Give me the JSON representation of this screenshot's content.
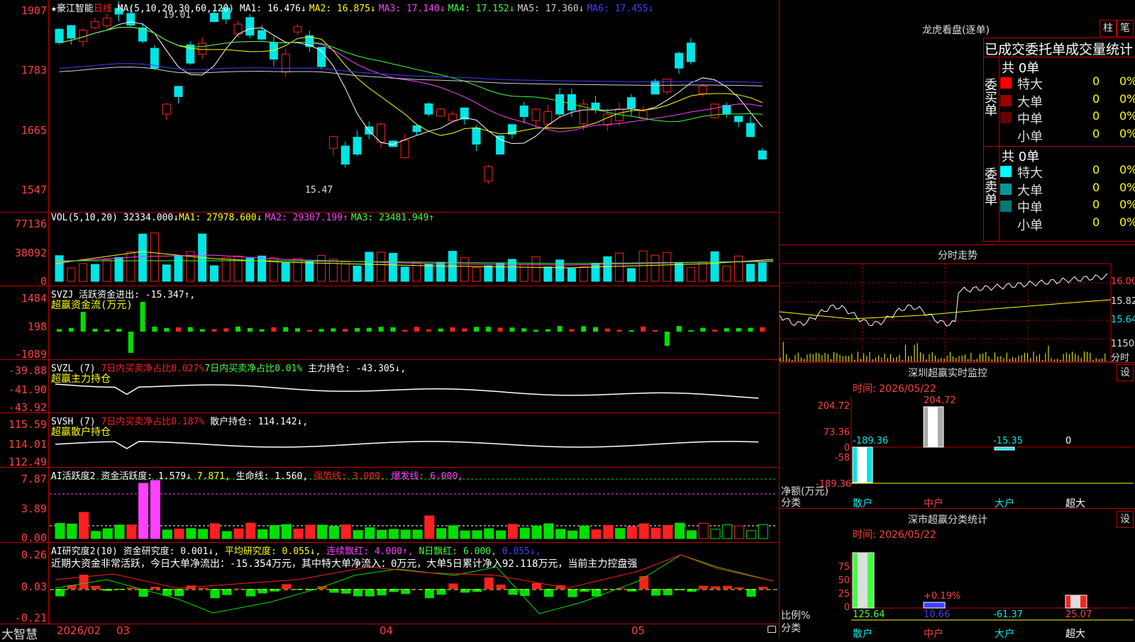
{
  "colors": {
    "up": "#ff2020",
    "down": "#00e5e5",
    "grid": "#c00000",
    "bg": "#000000"
  },
  "main": {
    "stock_name": "★豪江智能",
    "period": "日线",
    "ma_title": "MA(5,10,20,30,60,120)",
    "ma_items": [
      {
        "label": "MA1: 16.476↓",
        "color": "#ffffff"
      },
      {
        "label": "MA2: 16.875↓",
        "color": "#ffff00"
      },
      {
        "label": "MA3: 17.140↓",
        "color": "#ff40ff"
      },
      {
        "label": "MA4: 17.152↓",
        "color": "#40ff40"
      },
      {
        "label": "MA5: 17.360↓",
        "color": "#d0d0d0"
      },
      {
        "label": "MA6: 17.455↓",
        "color": "#4040ff"
      }
    ],
    "axis": [
      "1907",
      "1783",
      "1665",
      "1547"
    ],
    "high_label": "19.01",
    "low_label": "15.47"
  },
  "vol": {
    "title": "VOL(5,10,20)",
    "value": "32334.000↓",
    "items": [
      {
        "label": "MA1: 27978.600↓",
        "color": "#ffff00"
      },
      {
        "label": "MA2: 29307.199↑",
        "color": "#ff40ff"
      },
      {
        "label": "MA3: 23481.949↑",
        "color": "#40ff40"
      }
    ],
    "axis": [
      "77136",
      "38092",
      "0"
    ]
  },
  "svzj": {
    "title": "SVZJ",
    "desc": "活跃资金进出: -15.347↑,",
    "sub": "超赢资金流(万元)",
    "axis": [
      "1484",
      "198",
      "-1089"
    ]
  },
  "svzl": {
    "title": "SVZL (7)",
    "a": "7日内买卖净占比0.027%",
    "b": "7日内买卖净占比0.01%",
    "c": "主力持仓: -43.305↓,",
    "sub": "超赢主力持仓",
    "axis": [
      "-39.88",
      "-41.90",
      "-43.92"
    ]
  },
  "svsh": {
    "title": "SVSH (7)",
    "a": "7日内买卖净占比0.187%",
    "c": "散户持仓: 114.142↓,",
    "sub": "超赢散户持仓",
    "axis": [
      "115.59",
      "114.01",
      "112.49"
    ]
  },
  "ai1": {
    "title": "AI活跃度2",
    "a": "资金活跃度: 1.579↓",
    "b": "7.871,",
    "c": "生命线: 1.560,",
    "d": "强势线: 3.000,",
    "e": "爆发线: 6.000,",
    "axis": [
      "7.87",
      "3.89",
      "0.00"
    ]
  },
  "ai2": {
    "title": "AI研究度2(10)",
    "a": "资金研究度: 0.001↓,",
    "b": "平均研究度: 0.055↓,",
    "c": "连续飘红: 4.000↑,",
    "d": "N日飘红: 6.000,",
    "e": "0.055↓,",
    "note": "近期大资金非常活跃，今日大单净流出：-15.354万元，其中特大单净流入：0万元，大单5日累计净入92.118万元，当前主力控盘强",
    "axis": [
      "0.26",
      "0.03",
      "-0.21"
    ]
  },
  "bottom": {
    "logo": "大智慧",
    "dates": [
      "2026/02",
      "03",
      "04",
      "05"
    ]
  },
  "right": {
    "title": "龙虎看盘(逐单)",
    "btn1": "柱",
    "btn2": "笔",
    "stats_title": "已成交委托单成交量统计",
    "buy_label": "委买单",
    "sell_label": "委卖单",
    "buy_total": "共 0单",
    "sell_total": "共 0单",
    "buy_rows": [
      {
        "label": "特大",
        "v1": "0",
        "v2": "0%",
        "color": "#ff0000"
      },
      {
        "label": "大单",
        "v1": "0",
        "v2": "0%",
        "color": "#990000"
      },
      {
        "label": "中单",
        "v1": "0",
        "v2": "0%",
        "color": "#660000"
      },
      {
        "label": "小单",
        "v1": "0",
        "v2": "0%",
        "color": "#000000"
      }
    ],
    "sell_rows": [
      {
        "label": "特大",
        "v1": "0",
        "v2": "0%",
        "color": "#00ffff"
      },
      {
        "label": "大单",
        "v1": "0",
        "v2": "0%",
        "color": "#009999"
      },
      {
        "label": "中单",
        "v1": "0",
        "v2": "0%",
        "color": "#007777"
      },
      {
        "label": "小单",
        "v1": "0",
        "v2": "0%",
        "color": "#000000"
      }
    ],
    "intraday_title": "分时走势",
    "intraday_axis": [
      "16.00",
      "15.82",
      "15.64"
    ],
    "intraday_vol": "1150",
    "intraday_unit": "分时",
    "monitor_title": "深圳超赢实时监控",
    "monitor_btn": "设",
    "monitor_time": "时间: 2026/05/22",
    "monitor_axis": [
      "204.72",
      "73.36",
      "0",
      "-58",
      "-189.36"
    ],
    "monitor_values": [
      "-189.36",
      "204.72",
      "-15.35",
      "0"
    ],
    "monitor_unit1": "净额(万元)",
    "monitor_unit2": "分类",
    "cats": [
      "散户",
      "中户",
      "大户",
      "超大"
    ],
    "class_title": "深市超赢分类统计",
    "class_btn": "设",
    "class_time": "时间: 2026/05/22",
    "class_axis": [
      "75",
      "50",
      "25",
      "0"
    ],
    "class_values": [
      "125.64",
      "10.66",
      "-61.37",
      "25.07"
    ],
    "class_pct": "+0.19%",
    "class_unit1": "比例%",
    "class_unit2": "分类"
  }
}
